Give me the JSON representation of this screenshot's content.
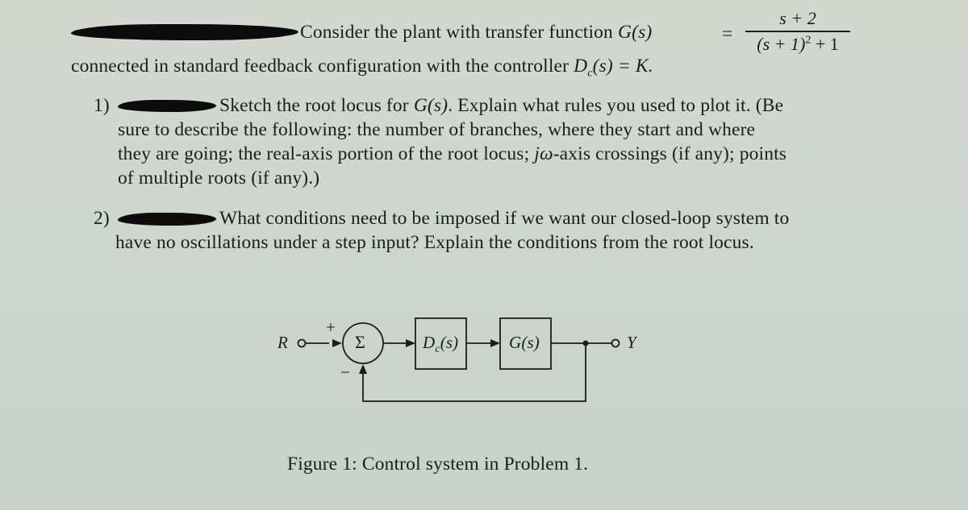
{
  "intro": {
    "line1": "Consider the plant with transfer function ",
    "plant_label": "G(s)",
    "equals": "=",
    "numerator": "s + 2",
    "denominator_base": "(s + 1)",
    "denominator_exp": "2",
    "denominator_tail": " + 1",
    "line2_text": "connected in standard feedback configuration with the controller ",
    "controller_D": "D",
    "controller_sub": "c",
    "controller_rest": "(s) = K."
  },
  "questions": [
    {
      "number": "1)",
      "line1": "Sketch the root locus for ",
      "line1_math": "G(s)",
      "line1_end": ". Explain what rules you used to plot it. (Be",
      "line2": "sure to describe the following: the number of branches, where they start and where",
      "line3_start": "they are going; the real-axis portion of the root locus; ",
      "line3_math": "jω",
      "line3_end": "-axis crossings (if any); points",
      "line4": "of multiple roots (if any).)"
    },
    {
      "number": "2)",
      "line1": "What conditions need to be imposed if we want our closed-loop system to",
      "line2": "have no oscillations under a step input? Explain the conditions from the root locus."
    }
  ],
  "diagram": {
    "input_label": "R",
    "output_label": "Y",
    "plus_sign": "+",
    "minus_sign": "−",
    "summer_symbol": "Σ",
    "controller_block": "D",
    "controller_block_sub": "c",
    "controller_block_rest": "(s)",
    "plant_block": "G(s)"
  },
  "caption": "Figure 1: Control system in Problem 1."
}
